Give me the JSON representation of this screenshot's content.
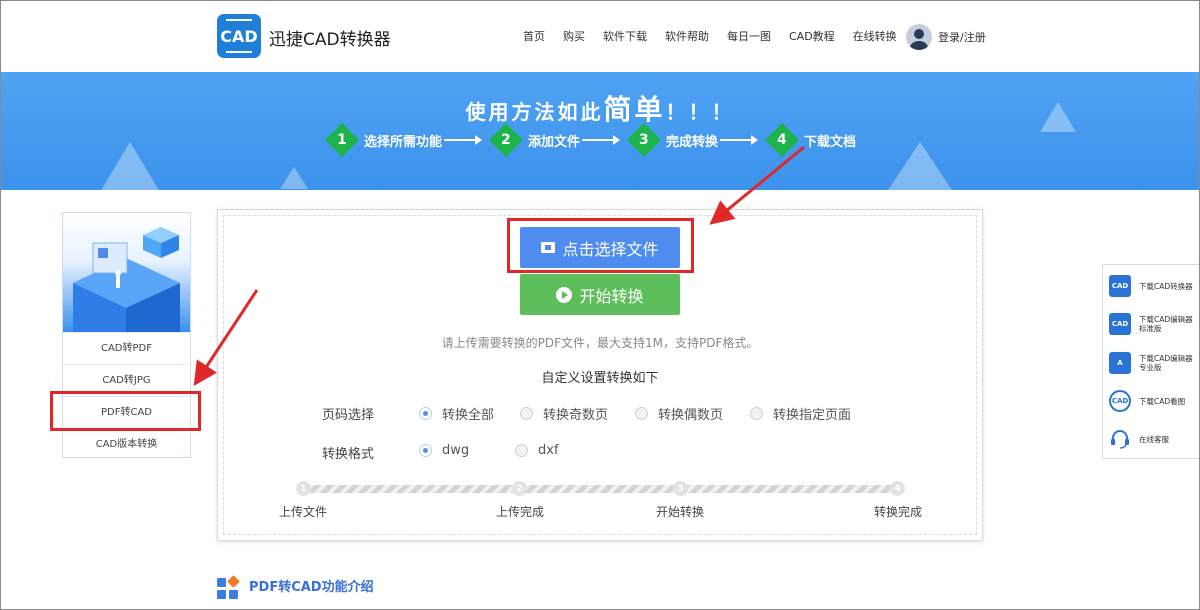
{
  "header": {
    "logo_text": "CAD",
    "brand": "迅捷CAD转换器",
    "nav": [
      "首页",
      "购买",
      "软件下载",
      "软件帮助",
      "每日一图",
      "CAD教程",
      "在线转换"
    ],
    "login": "登录/注册"
  },
  "banner": {
    "title_prefix": "使用方法如此",
    "title_emphasis": "简单",
    "title_suffix": "！！！",
    "steps": [
      {
        "num": "1",
        "label": "选择所需功能"
      },
      {
        "num": "2",
        "label": "添加文件"
      },
      {
        "num": "3",
        "label": "完成转换"
      },
      {
        "num": "4",
        "label": "下载文档"
      }
    ]
  },
  "sidebar": {
    "items": [
      {
        "label": "CAD转PDF"
      },
      {
        "label": "CAD转JPG"
      },
      {
        "label": "PDF转CAD"
      },
      {
        "label": "CAD版本转换"
      }
    ]
  },
  "main": {
    "select_button": "点击选择文件",
    "start_button": "开始转换",
    "hint": "请上传需要转换的PDF文件，最大支持1M，支持PDF格式。",
    "custom_title": "自定义设置转换如下",
    "page_label": "页码选择",
    "page_options": [
      "转换全部",
      "转换奇数页",
      "转换偶数页",
      "转换指定页面"
    ],
    "page_selected": "转换全部",
    "format_label": "转换格式",
    "format_options": [
      "dwg",
      "dxf"
    ],
    "format_selected": "dwg",
    "progress_steps": [
      {
        "num": "1",
        "label": "上传文件"
      },
      {
        "num": "2",
        "label": "上传完成"
      },
      {
        "num": "3",
        "label": "开始转换"
      },
      {
        "num": "4",
        "label": "转换完成"
      }
    ]
  },
  "section": {
    "title": "PDF转CAD功能介绍"
  },
  "right_panel": {
    "items": [
      {
        "icon": "CAD",
        "line1": "下载CAD转换器",
        "line2": ""
      },
      {
        "icon": "CAD",
        "line1": "下载CAD编辑器",
        "line2": "标准版"
      },
      {
        "icon": "A",
        "line1": "下载CAD编辑器",
        "line2": "专业版"
      },
      {
        "icon": "CAD",
        "line1": "下载CAD看图",
        "line2": ""
      },
      {
        "icon": "headset-icon",
        "line1": "在线客服",
        "line2": ""
      }
    ]
  },
  "colors": {
    "primary_blue": "#4f8cf0",
    "start_green": "#5cbf5c",
    "banner_blue": "#4ea3f3",
    "step_green": "#1bb34a",
    "annotation_red": "#e02828",
    "section_title_blue": "#3a6fd6"
  }
}
